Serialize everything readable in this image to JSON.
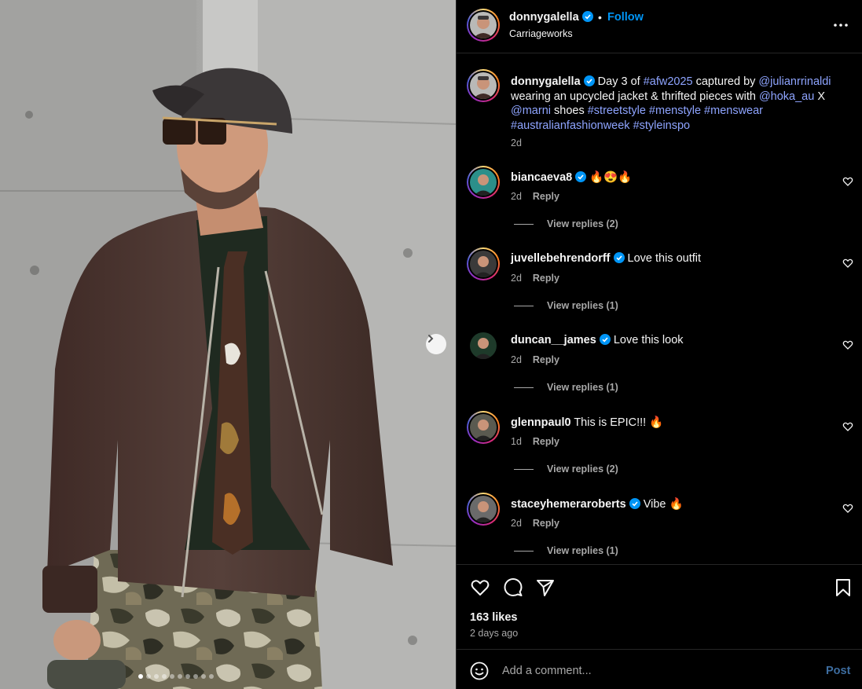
{
  "post": {
    "username": "donnygalella",
    "follow_label": "Follow",
    "separator": "•",
    "location": "Carriageworks",
    "more_icon": "more-horizontal-icon"
  },
  "carousel": {
    "slide_count": 10,
    "active_slide": 1,
    "next_icon": "chevron-right-icon"
  },
  "caption": {
    "username": "donnygalella",
    "text_parts": [
      {
        "text": "Day 3 of ",
        "link": false
      },
      {
        "text": "#afw2025",
        "link": true
      },
      {
        "text": " captured by ",
        "link": false
      },
      {
        "text": "@julianrrinaldi",
        "link": true
      },
      {
        "text": " wearing an upcycled jacket & thrifted pieces with ",
        "link": false
      },
      {
        "text": "@hoka_au",
        "link": true
      },
      {
        "text": " X ",
        "link": false
      },
      {
        "text": "@marni",
        "link": true
      },
      {
        "text": " shoes ",
        "link": false
      },
      {
        "text": "#streetstyle",
        "link": true
      },
      {
        "text": " ",
        "link": false
      },
      {
        "text": "#menstyle",
        "link": true
      },
      {
        "text": " ",
        "link": false
      },
      {
        "text": "#menswear",
        "link": true
      },
      {
        "text": " ",
        "link": false
      },
      {
        "text": "#australianfashionweek",
        "link": true
      },
      {
        "text": " ",
        "link": false
      },
      {
        "text": "#styleinspo",
        "link": true
      }
    ],
    "time": "2d"
  },
  "comments": [
    {
      "username": "biancaeva8",
      "verified": true,
      "text": "🔥😍🔥",
      "time": "2d",
      "reply_label": "Reply",
      "view_replies": "View replies (2)"
    },
    {
      "username": "juvellebehrendorff",
      "verified": true,
      "text": "Love this outfit",
      "time": "2d",
      "reply_label": "Reply",
      "view_replies": "View replies (1)"
    },
    {
      "username": "duncan__james",
      "verified": true,
      "text": "Love this look",
      "time": "2d",
      "reply_label": "Reply",
      "view_replies": "View replies (1)"
    },
    {
      "username": "glennpaul0",
      "verified": false,
      "text": "This is EPIC!!! 🔥",
      "time": "1d",
      "reply_label": "Reply",
      "view_replies": "View replies (2)"
    },
    {
      "username": "staceyhemeraroberts",
      "verified": true,
      "text": "Vibe 🔥",
      "time": "2d",
      "reply_label": "Reply",
      "view_replies": "View replies (1)"
    }
  ],
  "actions": {
    "like_icon": "heart-icon",
    "comment_icon": "comment-icon",
    "share_icon": "send-icon",
    "save_icon": "bookmark-icon",
    "likes": "163 likes",
    "posted_ago": "2 days ago"
  },
  "add_comment": {
    "emoji_icon": "emoji-icon",
    "placeholder": "Add a comment...",
    "post_label": "Post"
  },
  "colors": {
    "background": "#000000",
    "link": "#8ea4ff",
    "follow": "#0095f6",
    "muted": "#a8a8a8",
    "verified": "#0095f6"
  }
}
